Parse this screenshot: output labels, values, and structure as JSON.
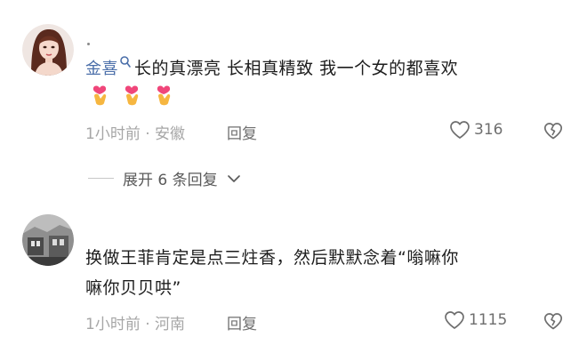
{
  "comments": [
    {
      "username": "金喜",
      "text": "长的真漂亮 长相真精致 我一个女的都喜欢",
      "emoji": [
        "finger-heart-emoji",
        "finger-heart-emoji",
        "finger-heart-emoji"
      ],
      "meta": "1小时前 · 安徽",
      "reply_label": "回复",
      "likes": "316",
      "replies_toggle": "展开 6 条回复"
    },
    {
      "text_line1": "换做王菲肯定是点三炷香，然后默默念着“嗡嘛你",
      "text_line2": "嘛你贝贝哄”",
      "meta": "1小时前 · 河南",
      "reply_label": "回复",
      "likes": "1115"
    }
  ],
  "colors": {
    "username": "#4a6ea9",
    "text": "#1d1d1d",
    "meta": "#a6a6a6",
    "icon": "#6e6e6e"
  },
  "icons": [
    "search-icon",
    "heart-icon",
    "broken-heart-icon",
    "chevron-down-icon"
  ]
}
